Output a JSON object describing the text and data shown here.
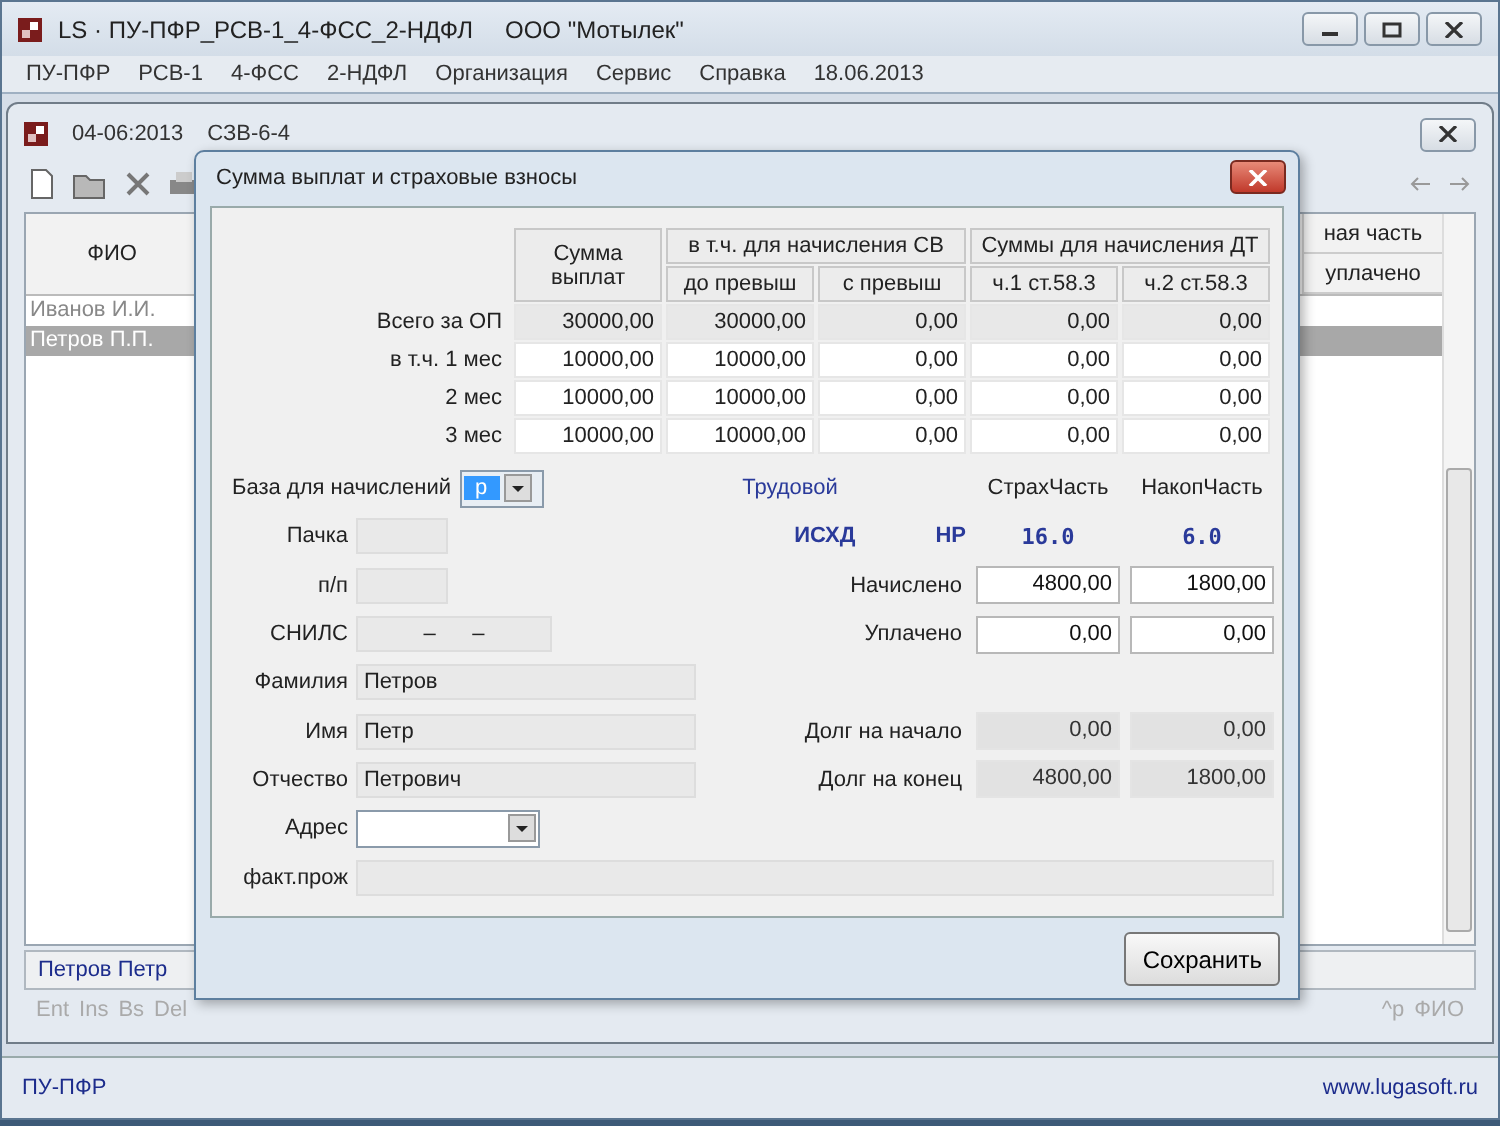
{
  "window": {
    "title": "LS · ПУ-ПФР_РСВ-1_4-ФСС_2-НДФЛ",
    "organization": "ООО \"Мотылек\""
  },
  "menu": {
    "items": [
      "ПУ-ПФР",
      "РСВ-1",
      "4-ФСС",
      "2-НДФЛ",
      "Организация",
      "Сервис",
      "Справка"
    ],
    "date": "18.06.2013"
  },
  "document_window": {
    "title": "04-06:2013",
    "subtitle": "СЗВ-6-4",
    "table": {
      "name_column": "ФИО",
      "right_column": "ная часть",
      "right_subcolumn": "уплачено",
      "rows": [
        {
          "name": "Иванов И.И.",
          "selected": false
        },
        {
          "name": "Петров П.П.",
          "selected": true
        }
      ]
    },
    "footer": "Петров Петр",
    "hints_left": [
      "Ent",
      "Ins",
      "Bs",
      "Del"
    ],
    "hints_right": [
      "^p",
      "ФИО"
    ]
  },
  "dialog": {
    "title": "Сумма выплат и страховые взносы",
    "table": {
      "first_column": "Сумма выплат",
      "groups": [
        {
          "label": "в т.ч. для начисления СВ",
          "columns": [
            "до превыш",
            "с превыш"
          ]
        },
        {
          "label": "Суммы для начисления ДТ",
          "columns": [
            "ч.1 ст.58.3",
            "ч.2 ст.58.3"
          ]
        }
      ],
      "rows": [
        {
          "label": "Всего за ОП",
          "kind": "total",
          "cells": [
            "30000,00",
            "30000,00",
            "0,00",
            "0,00",
            "0,00"
          ]
        },
        {
          "label": "в т.ч. 1 мес",
          "kind": "month",
          "cells": [
            "10000,00",
            "10000,00",
            "0,00",
            "0,00",
            "0,00"
          ]
        },
        {
          "label": "2 мес",
          "kind": "month",
          "cells": [
            "10000,00",
            "10000,00",
            "0,00",
            "0,00",
            "0,00"
          ]
        },
        {
          "label": "3 мес",
          "kind": "month",
          "cells": [
            "10000,00",
            "10000,00",
            "0,00",
            "0,00",
            "0,00"
          ]
        }
      ]
    },
    "base": {
      "label": "База для начислений",
      "value": "р"
    },
    "fields": [
      {
        "label": "Пачка",
        "kind": "short"
      },
      {
        "label": "п/п",
        "kind": "short"
      },
      {
        "label": "СНИЛС",
        "value": "–      –",
        "kind": "snils"
      },
      {
        "label": "Фамилия",
        "value": "Петров",
        "kind": "wide"
      },
      {
        "label": "Имя",
        "value": "Петр",
        "kind": "wide"
      },
      {
        "label": "Отчество",
        "value": "Петрович",
        "kind": "wide"
      }
    ],
    "address": {
      "label": "Адрес"
    },
    "residence": {
      "label": "факт.прож"
    },
    "regime": "Трудовой",
    "columns": [
      "СтрахЧасть",
      "НакопЧасть"
    ],
    "codes": [
      "ИСХД",
      "НР"
    ],
    "rates": [
      "16.0",
      "6.0"
    ],
    "amounts": [
      {
        "label": "Начислено",
        "values": [
          "4800,00",
          "1800,00"
        ],
        "editable": true
      },
      {
        "label": "Уплачено",
        "values": [
          "0,00",
          "0,00"
        ],
        "editable": true
      },
      {
        "label": "Долг на начало",
        "values": [
          "0,00",
          "0,00"
        ],
        "editable": false
      },
      {
        "label": "Долг на конец",
        "values": [
          "4800,00",
          "1800,00"
        ],
        "editable": false
      }
    ],
    "save_button": "Сохранить"
  },
  "status_bar": {
    "left": "ПУ-ПФР",
    "right": "www.lugasoft.ru"
  }
}
